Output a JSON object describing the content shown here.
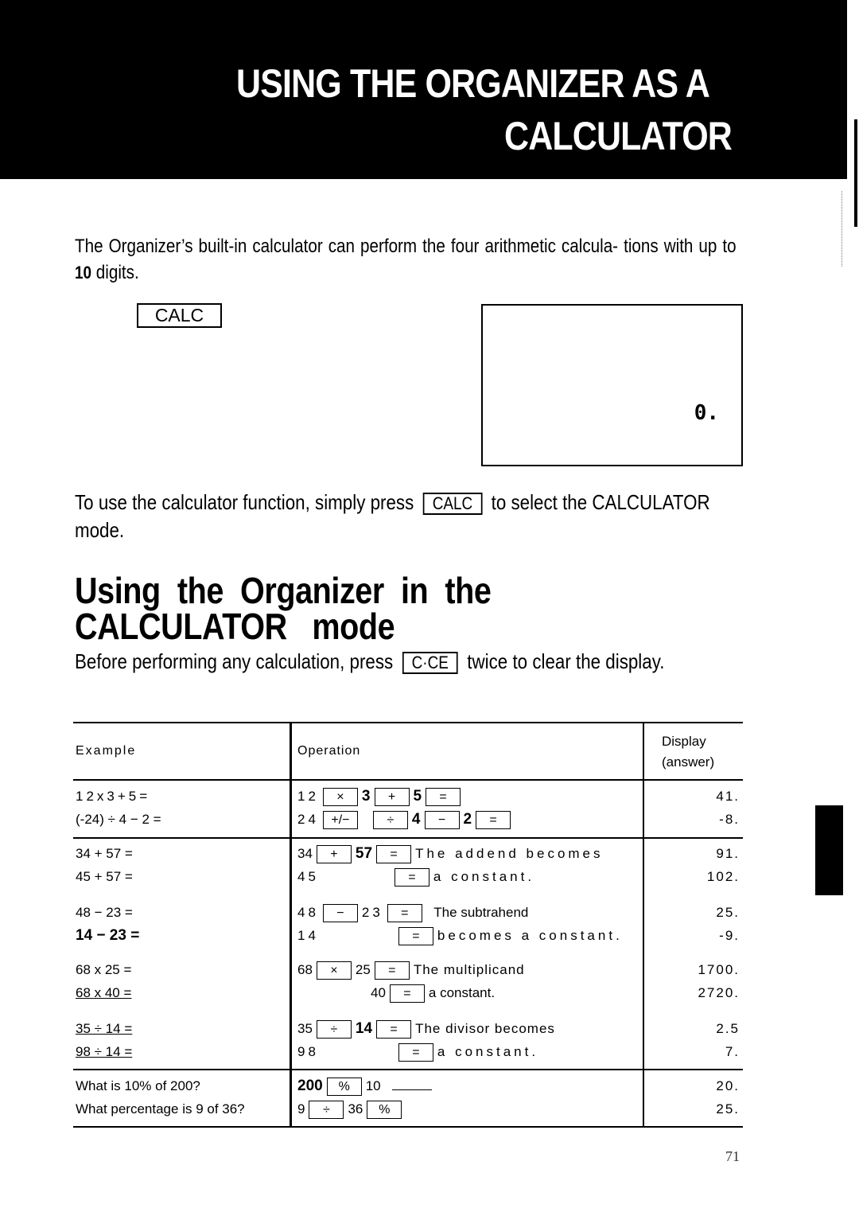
{
  "banner": {
    "title_line1": "USING THE ORGANIZER AS A",
    "title_line2": "CALCULATOR"
  },
  "intro": {
    "text_before": "The Organizer’s built-in calculator can perform the four arithmetic calcula- tions with up to ",
    "digits": "10",
    "text_after": " digits."
  },
  "calc_key_label": "CALC",
  "lcd_display": "0.",
  "usage": {
    "text_before": "To use the calculator function, simply press",
    "key": "CALC",
    "text_after": "to select the CALCULATOR  mode."
  },
  "section": {
    "heading_line1": "Using  the  Organizer  in  the",
    "heading_line2": "CALCULATOR   mode"
  },
  "before": {
    "text_before": "Before performing any calculation, press",
    "key": "C·CE",
    "text_after": "twice to clear the display."
  },
  "table": {
    "headers": {
      "example": "Example",
      "operation": "Operation",
      "display_line1": "Display",
      "display_line2": "(answer)"
    },
    "rows": [
      {
        "example": "12x3+5=",
        "operation": {
          "parts": [
            "12",
            "[×]",
            "3",
            "[+]",
            "5",
            "[=]"
          ]
        },
        "display": "41."
      },
      {
        "example": "(-24) ÷ 4 − 2 =",
        "operation": {
          "parts": [
            "24",
            "[+/−]",
            "[÷]",
            "4",
            "[−]",
            "2",
            "[=]"
          ]
        },
        "display": "-8."
      },
      {
        "example": "34 + 57 =",
        "operation": {
          "parts": [
            "34",
            "[+]",
            "57",
            "[=]"
          ],
          "note": "The addend becomes"
        },
        "display": "91."
      },
      {
        "example": "45 + 57 =",
        "operation": {
          "parts": [
            "45",
            "[=]"
          ],
          "note": "a constant."
        },
        "display": "102."
      },
      {
        "example": "48 − 23 =",
        "operation": {
          "parts": [
            "48",
            "[−]",
            "23",
            "[=]"
          ],
          "note": "The subtrahend"
        },
        "display": "25."
      },
      {
        "example": "14 − 23 =",
        "operation": {
          "parts": [
            "14",
            "[=]"
          ],
          "note": "becomes a constant."
        },
        "display": "-9."
      },
      {
        "example": "68 x 25 =",
        "operation": {
          "parts": [
            "68",
            "[×]",
            "25",
            "[=]"
          ],
          "note": "The multiplicand"
        },
        "display": "1700."
      },
      {
        "example": "68 x 40 =",
        "operation": {
          "parts": [
            "40",
            "[=]"
          ],
          "note": "a constant."
        },
        "display": "2720."
      },
      {
        "example": "35 ÷ 14 =",
        "operation": {
          "parts": [
            "35",
            "[÷]",
            "14",
            "[=]"
          ],
          "note": "The divisor becomes"
        },
        "display": "2.5"
      },
      {
        "example": "98 ÷ 14 =",
        "operation": {
          "parts": [
            "98",
            "[=]"
          ],
          "note": "a constant."
        },
        "display": "7."
      },
      {
        "example": "What is 10% of 200?",
        "operation": {
          "parts": [
            "200",
            "[%]",
            "10"
          ]
        },
        "display": "20."
      },
      {
        "example": "What percentage is 9 of 36?",
        "operation": {
          "parts": [
            "9",
            "[÷]",
            "36",
            "[%]"
          ]
        },
        "display": "25."
      }
    ]
  },
  "keys": {
    "multiply": "×",
    "plus": "+",
    "minus": "−",
    "equals": "=",
    "divide": "÷",
    "sign": "+/−",
    "percent": "%"
  },
  "page_number": "71"
}
